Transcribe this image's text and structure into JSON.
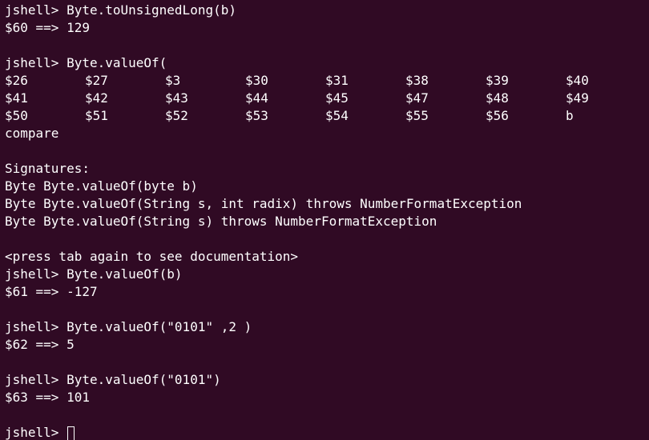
{
  "terminal": {
    "lines": [
      "jshell> Byte.toUnsignedLong(b)",
      "$60 ==> 129",
      "",
      "jshell> Byte.valueOf("
    ],
    "completions": [
      [
        "$26",
        "$27",
        "$3",
        "$30",
        "$31",
        "$38",
        "$39",
        "$40"
      ],
      [
        "$41",
        "$42",
        "$43",
        "$44",
        "$45",
        "$47",
        "$48",
        "$49"
      ],
      [
        "$50",
        "$51",
        "$52",
        "$53",
        "$54",
        "$55",
        "$56",
        "b"
      ]
    ],
    "after_completions": [
      "compare",
      "",
      "Signatures:",
      "Byte Byte.valueOf(byte b)",
      "Byte Byte.valueOf(String s, int radix) throws NumberFormatException",
      "Byte Byte.valueOf(String s) throws NumberFormatException",
      "",
      "<press tab again to see documentation>",
      "jshell> Byte.valueOf(b)",
      "$61 ==> -127",
      "",
      "jshell> Byte.valueOf(\"0101\" ,2 )",
      "$62 ==> 5",
      "",
      "jshell> Byte.valueOf(\"0101\")",
      "$63 ==> 101",
      ""
    ],
    "prompt": "jshell> ",
    "colors": {
      "background": "#300a24",
      "foreground": "#ffffff"
    }
  }
}
